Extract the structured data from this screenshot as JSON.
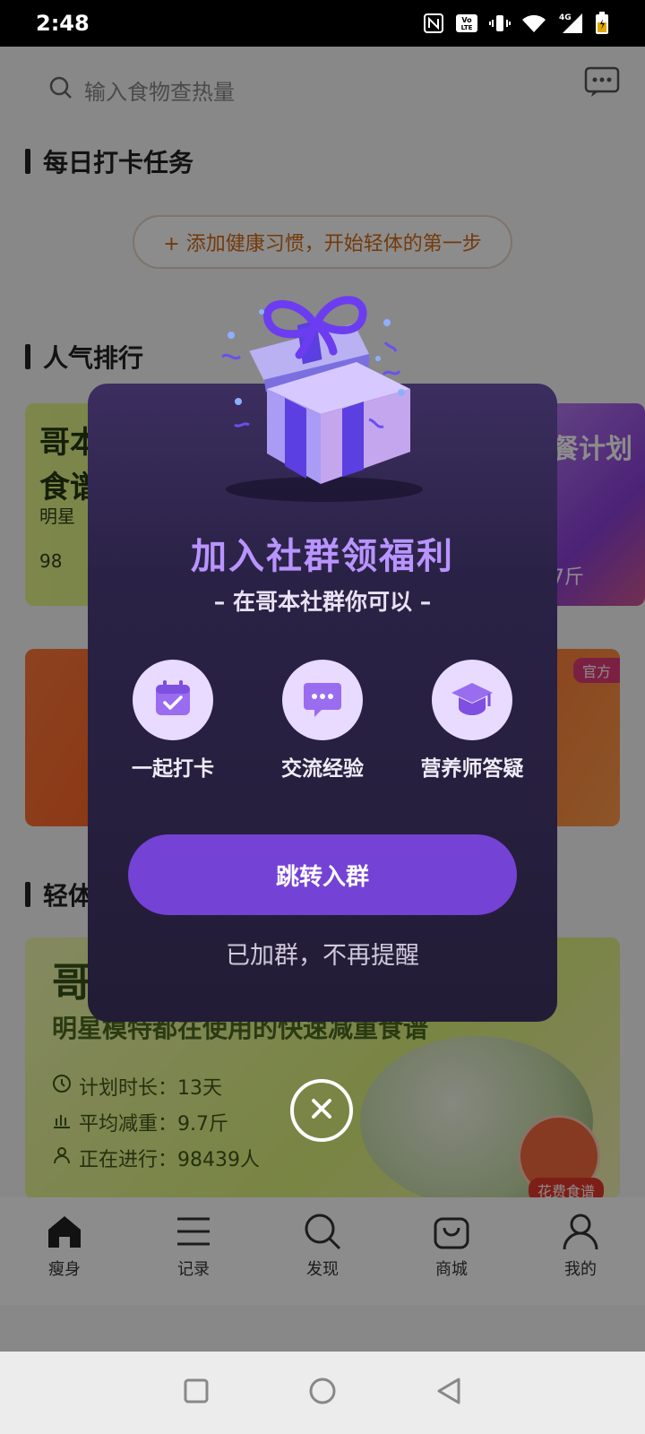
{
  "status_bar": {
    "time": "2:48",
    "network": "4G"
  },
  "search": {
    "placeholder": "输入食物查热量"
  },
  "sections": {
    "daily_tasks": "每日打卡任务",
    "popular_ranking": "人气排行",
    "light_body": "轻体"
  },
  "habit_button": {
    "label": "+ 添加健康习惯，开始轻体的第一步"
  },
  "ranking_card": {
    "title_line1": "哥本",
    "title_line2": "食谱",
    "subtitle": "明星",
    "participants_prefix": "98",
    "right_title": "餐计划",
    "right_weight": "7斤"
  },
  "banner": {
    "badge": "官方"
  },
  "plan_card": {
    "brand": "哥",
    "subtitle": "明星模特都在使用的快速减重食谱",
    "duration": "计划时长：13天",
    "avg_loss": "平均减重：9.7斤",
    "ongoing": "正在进行：98439人",
    "chef_label": "花费食谱"
  },
  "modal": {
    "title": "加入社群领福利",
    "subtitle": "– 在哥本社群你可以 –",
    "features": [
      {
        "label": "一起打卡",
        "icon": "calendar-check-icon"
      },
      {
        "label": "交流经验",
        "icon": "chat-bubble-icon"
      },
      {
        "label": "营养师答疑",
        "icon": "graduation-cap-icon"
      }
    ],
    "join_button": "跳转入群",
    "dismiss_link": "已加群，不再提醒"
  },
  "tabbar": {
    "items": [
      {
        "label": "瘦身",
        "icon": "home-icon"
      },
      {
        "label": "记录",
        "icon": "list-icon"
      },
      {
        "label": "发现",
        "icon": "search-icon"
      },
      {
        "label": "商城",
        "icon": "bag-icon"
      },
      {
        "label": "我的",
        "icon": "user-icon"
      }
    ]
  },
  "colors": {
    "accent_purple": "#7442d5",
    "title_purple": "#b994ff",
    "habit_orange": "#d26a14"
  }
}
